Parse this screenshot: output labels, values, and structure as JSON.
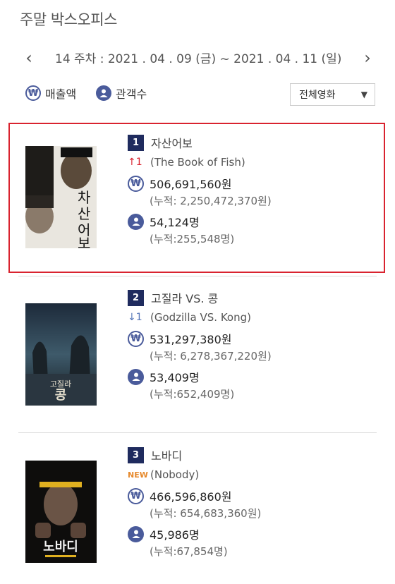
{
  "page": {
    "title": "주말 박스오피스"
  },
  "week": {
    "prev_icon": "chevron-left",
    "next_icon": "chevron-right",
    "label": "14 주차 : 2021 . 04 . 09 (금) ~ 2021 . 04 . 11 (일)"
  },
  "filters": {
    "revenue": {
      "icon": "won-icon",
      "label": "매출액"
    },
    "audience": {
      "icon": "user-icon",
      "label": "관객수"
    },
    "genre_select": {
      "value": "전체영화",
      "caret": "▼"
    }
  },
  "movies": [
    {
      "rank": "1",
      "title": "자산어보",
      "change_symbol": "↑",
      "change_value": "1",
      "english_title": "(The Book of Fish)",
      "revenue": "506,691,560원",
      "revenue_cumulative": "(누적: 2,250,472,370원)",
      "audience": "54,124명",
      "audience_cumulative": "(누적:255,548명)",
      "poster_text": "자산어보",
      "highlighted": true
    },
    {
      "rank": "2",
      "title": "고질라 VS. 콩",
      "change_symbol": "↓",
      "change_value": "1",
      "english_title": "(Godzilla VS. Kong)",
      "revenue": "531,297,380원",
      "revenue_cumulative": "(누적: 6,278,367,220원)",
      "audience": "53,409명",
      "audience_cumulative": "(누적:652,409명)",
      "poster_text": "고질라 콩",
      "highlighted": false
    },
    {
      "rank": "3",
      "title": "노바디",
      "change_symbol": "NEW",
      "change_value": "",
      "english_title": "(Nobody)",
      "revenue": "466,596,860원",
      "revenue_cumulative": "(누적: 654,683,360원)",
      "audience": "45,986명",
      "audience_cumulative": "(누적:67,854명)",
      "poster_text": "노바디",
      "highlighted": false
    }
  ],
  "colors": {
    "rank_badge": "#1f2b5e",
    "icon": "#4a5b9b",
    "up": "#d9232f",
    "down": "#5677b8",
    "new": "#e68a2e",
    "highlight_border": "#d9232f"
  }
}
